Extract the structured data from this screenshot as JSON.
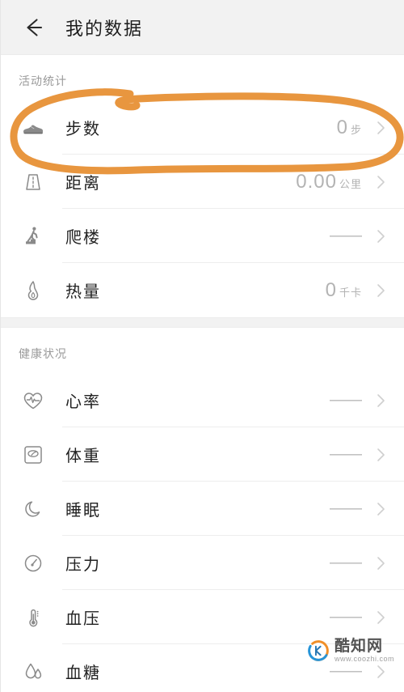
{
  "header": {
    "back_icon": "back-arrow-icon",
    "title": "我的数据"
  },
  "sections": [
    {
      "id": "activity",
      "title": "活动统计",
      "rows": [
        {
          "icon": "shoe-icon",
          "label": "步数",
          "value": "0",
          "unit": "步",
          "dash": false
        },
        {
          "icon": "road-icon",
          "label": "距离",
          "value": "0.00",
          "unit": "公里",
          "dash": false
        },
        {
          "icon": "stairs-icon",
          "label": "爬楼",
          "value": "——",
          "unit": "",
          "dash": true
        },
        {
          "icon": "flame-icon",
          "label": "热量",
          "value": "0",
          "unit": "千卡",
          "dash": false
        }
      ]
    },
    {
      "id": "health",
      "title": "健康状况",
      "rows": [
        {
          "icon": "heart-pulse-icon",
          "label": "心率",
          "value": "——",
          "unit": "",
          "dash": true
        },
        {
          "icon": "scale-icon",
          "label": "体重",
          "value": "——",
          "unit": "",
          "dash": true
        },
        {
          "icon": "moon-icon",
          "label": "睡眠",
          "value": "——",
          "unit": "",
          "dash": true
        },
        {
          "icon": "gauge-icon",
          "label": "压力",
          "value": "——",
          "unit": "",
          "dash": true
        },
        {
          "icon": "thermometer-icon",
          "label": "血压",
          "value": "——",
          "unit": "",
          "dash": true
        },
        {
          "icon": "blood-drop-icon",
          "label": "血糖",
          "value": "——",
          "unit": "",
          "dash": true
        }
      ]
    }
  ],
  "annotation": {
    "name": "orange-highlight-circle",
    "color": "#e8963f",
    "target": "步数"
  },
  "watermark": {
    "title": "酷知网",
    "url": "www.coozhi.com"
  },
  "colors": {
    "appbar_bg": "#f2f2f2",
    "page_bg": "#ffffff",
    "divider": "#ededed",
    "label": "#222222",
    "value": "#b3b3b3",
    "section_title": "#9a9a9a",
    "annotation_orange": "#e8963f"
  }
}
